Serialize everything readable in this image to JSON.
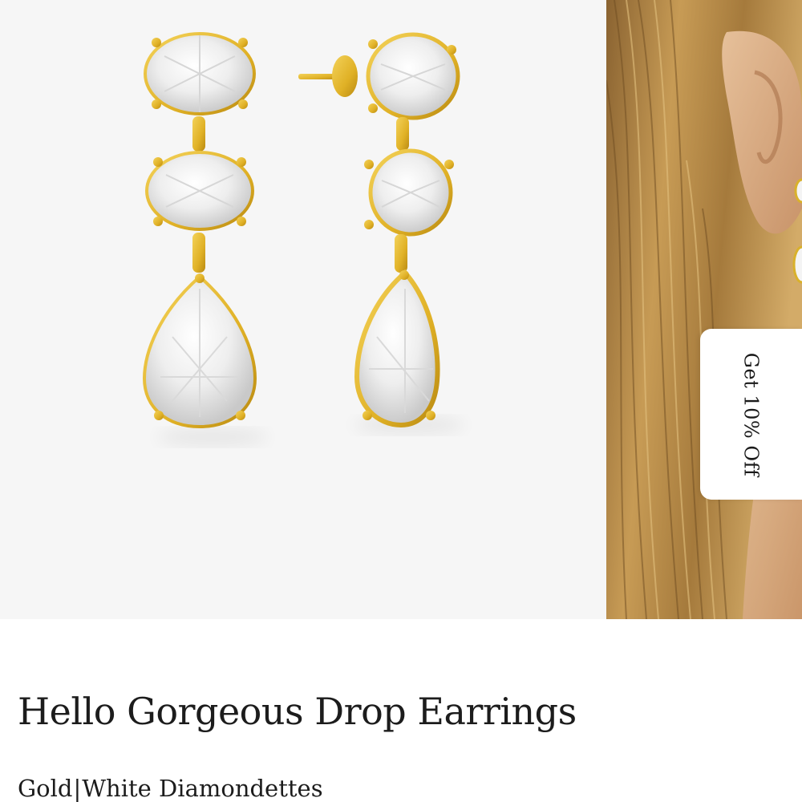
{
  "gallery": {
    "product_image_alt": "Hello Gorgeous Drop Earrings",
    "model_image_alt": "Model wearing earrings"
  },
  "promo": {
    "tab_label": "Get 10% Off"
  },
  "product": {
    "title": "Hello Gorgeous Drop Earrings",
    "metal": "Gold",
    "separator": "|",
    "stone": "White Diamondettes"
  },
  "colors": {
    "product_bg": "#f6f6f6",
    "gold": "#e2b62b",
    "text": "#1c1c1c",
    "hair": "#b98d4a"
  }
}
